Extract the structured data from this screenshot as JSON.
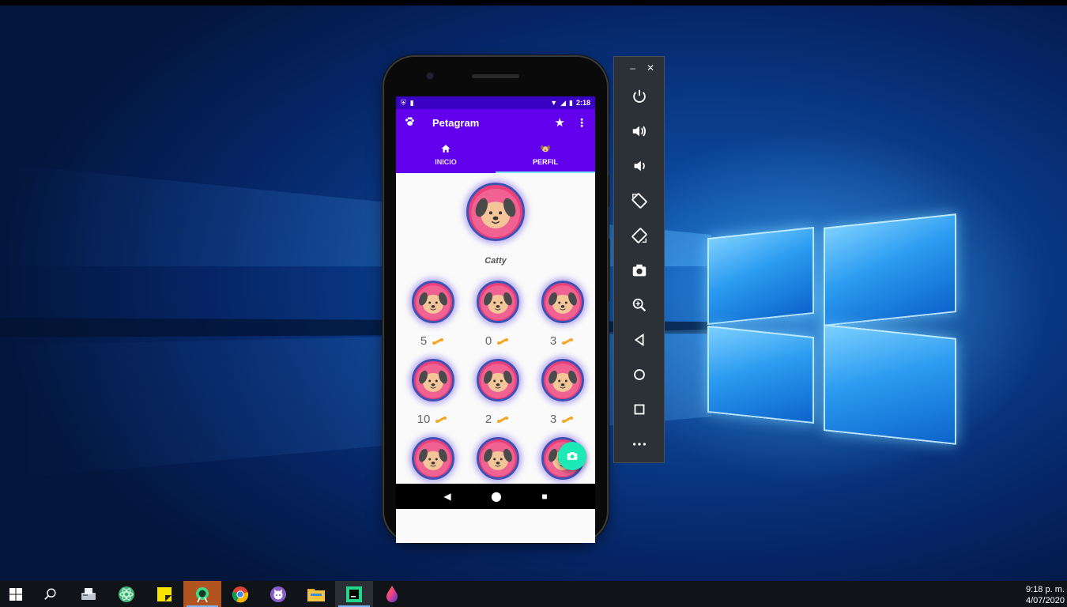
{
  "app": {
    "title": "Petagram",
    "tabs": [
      {
        "label": "INICIO",
        "icon": "home-icon",
        "active": false
      },
      {
        "label": "PERFIL",
        "icon": "dog-icon",
        "active": true
      }
    ]
  },
  "status_bar": {
    "time": "2:18"
  },
  "profile": {
    "name": "Catty"
  },
  "pets": [
    {
      "likes": "5"
    },
    {
      "likes": "0"
    },
    {
      "likes": "3"
    },
    {
      "likes": "10"
    },
    {
      "likes": "2"
    },
    {
      "likes": "3"
    },
    {
      "likes": ""
    },
    {
      "likes": ""
    },
    {
      "likes": ""
    }
  ],
  "emulator": {
    "buttons": [
      "power-icon",
      "volume-up-icon",
      "volume-down-icon",
      "rotate-left-icon",
      "rotate-right-icon",
      "screenshot-icon",
      "zoom-icon",
      "back-icon",
      "home-icon",
      "overview-icon",
      "more-icon"
    ]
  },
  "taskbar": {
    "items": [
      "windows-start-icon",
      "search-icon",
      "fax-icon",
      "atom-icon",
      "sticky-notes-icon",
      "android-studio-icon",
      "chrome-icon",
      "github-icon",
      "file-explorer-icon",
      "pycharm-icon",
      "paint-drop-icon"
    ],
    "clock_time": "9:18 p. m.",
    "clock_date": "4/07/2020"
  },
  "colors": {
    "primary": "#6200ee",
    "primary_dark": "#3a00c4",
    "accent": "#1de9b6",
    "avatar_pink": "#f06292"
  }
}
